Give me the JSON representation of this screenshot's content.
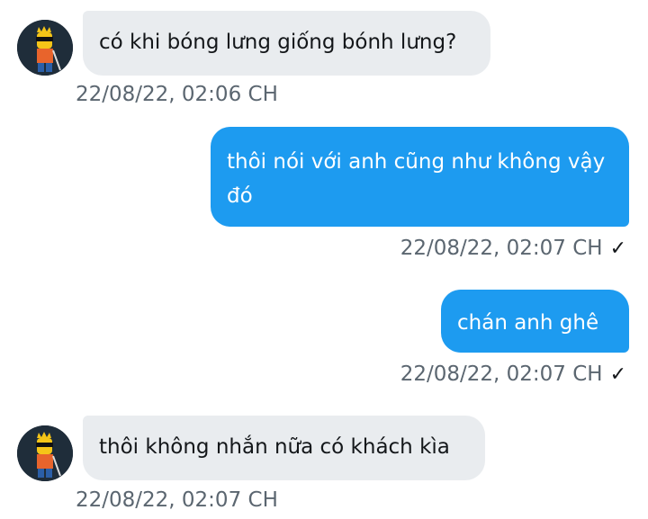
{
  "messages": [
    {
      "direction": "in",
      "text": "có khi bóng lưng giống bónh lưng?",
      "timestamp": "22/08/22,  02:06 CH"
    },
    {
      "direction": "out",
      "text": "thôi nói với anh cũng như không vậy đó",
      "timestamp": "22/08/22,  02:07 CH",
      "status_icon": "checkmark"
    },
    {
      "direction": "out",
      "text": "chán anh ghê",
      "timestamp": "22/08/22,  02:07 CH",
      "status_icon": "checkmark"
    },
    {
      "direction": "in",
      "text": "thôi không nhắn nữa có khách kìa",
      "timestamp": "22/08/22,  02:07 CH"
    }
  ],
  "read_check": "✓",
  "colors": {
    "outgoing_bubble": "#1d9bf0",
    "incoming_bubble": "#e9ecef",
    "timestamp": "#5b6670"
  }
}
